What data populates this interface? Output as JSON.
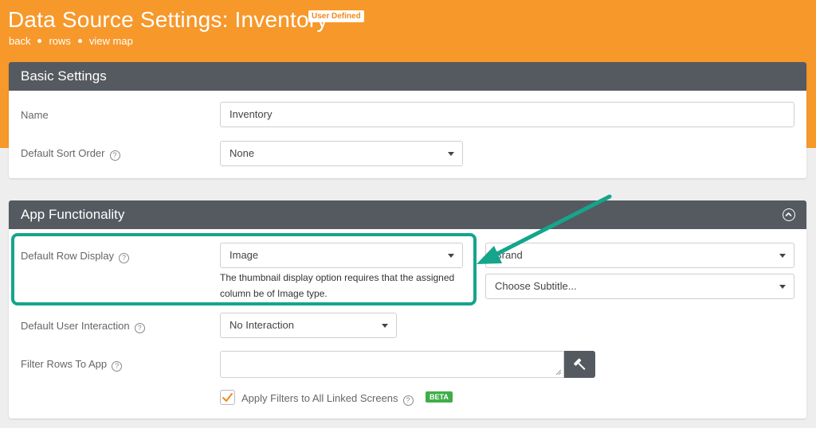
{
  "header": {
    "title": "Data Source Settings: Inventory",
    "badge": "User Defined",
    "breadcrumbs": [
      {
        "label": "back"
      },
      {
        "label": "rows"
      },
      {
        "label": "view map"
      }
    ]
  },
  "basic_settings": {
    "title": "Basic Settings",
    "name_label": "Name",
    "name_value": "Inventory",
    "sort_label": "Default Sort Order",
    "sort_value": "None"
  },
  "app_functionality": {
    "title": "App Functionality",
    "row_display_label": "Default Row Display",
    "row_display_value": "Image",
    "row_display_note": "The thumbnail display option requires that the assigned column be of Image type.",
    "title_select_value": "Brand",
    "subtitle_select_value": "Choose Subtitle...",
    "interaction_label": "Default User Interaction",
    "interaction_value": "No Interaction",
    "filter_label": "Filter Rows To App",
    "filter_value": "",
    "apply_filters_label": "Apply Filters to All Linked Screens",
    "apply_filters_checked": true,
    "beta_badge": "BETA"
  },
  "colors": {
    "header_bg": "#f7982b",
    "card_header_bg": "#555a60",
    "highlight": "#14a58b",
    "checkmark": "#f08a1d",
    "beta": "#3fae49"
  },
  "icons": {
    "help": "question-circle-icon",
    "collapse": "chevron-up-circle-icon",
    "tool": "hammer-icon",
    "caret": "caret-down-icon"
  }
}
